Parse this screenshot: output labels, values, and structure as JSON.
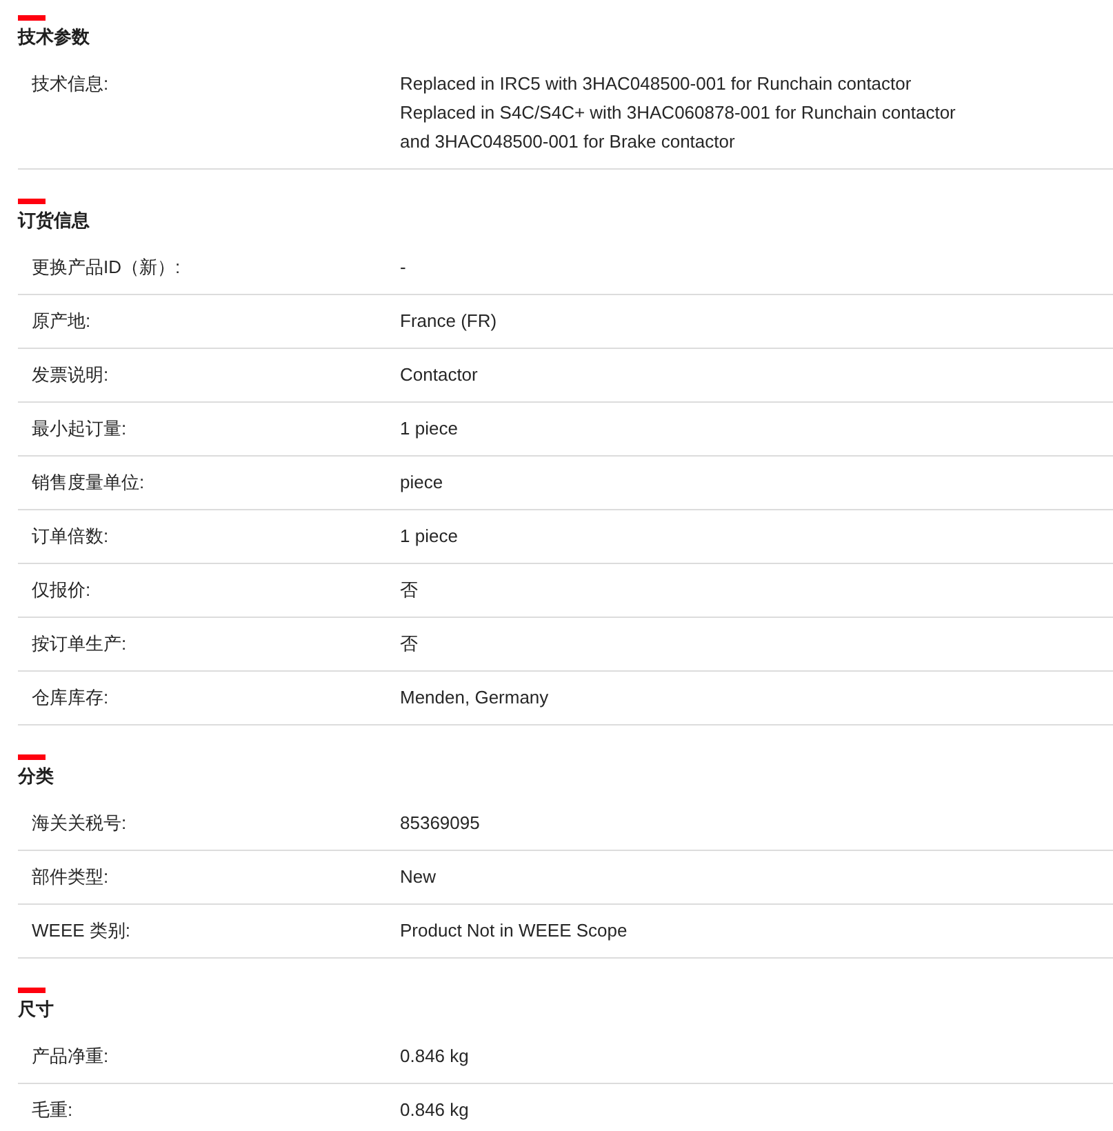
{
  "sections": [
    {
      "title": "技术参数",
      "rows": [
        {
          "label": "技术信息:",
          "value": "Replaced in IRC5 with 3HAC048500-001 for Runchain contactor\nReplaced in S4C/S4C+ with 3HAC060878-001 for Runchain contactor\nand 3HAC048500-001 for Brake contactor"
        }
      ]
    },
    {
      "title": "订货信息",
      "rows": [
        {
          "label": "更换产品ID（新）:",
          "value": "-"
        },
        {
          "label": "原产地:",
          "value": "France (FR)"
        },
        {
          "label": "发票说明:",
          "value": "Contactor"
        },
        {
          "label": "最小起订量:",
          "value": "1 piece"
        },
        {
          "label": "销售度量单位:",
          "value": "piece"
        },
        {
          "label": "订单倍数:",
          "value": "1 piece"
        },
        {
          "label": "仅报价:",
          "value": "否"
        },
        {
          "label": "按订单生产:",
          "value": "否"
        },
        {
          "label": "仓库库存:",
          "value": "Menden, Germany"
        }
      ]
    },
    {
      "title": "分类",
      "rows": [
        {
          "label": "海关关税号:",
          "value": "85369095"
        },
        {
          "label": "部件类型:",
          "value": "New"
        },
        {
          "label": "WEEE 类别:",
          "value": "Product Not in WEEE Scope"
        }
      ]
    },
    {
      "title": "尺寸",
      "rows": [
        {
          "label": "产品净重:",
          "value": "0.846 kg"
        },
        {
          "label": "毛重:",
          "value": "0.846 kg"
        }
      ]
    }
  ]
}
